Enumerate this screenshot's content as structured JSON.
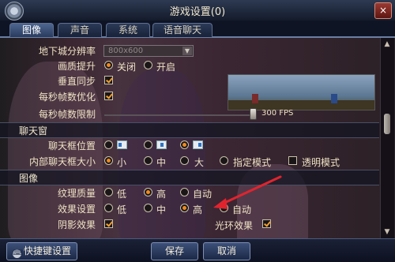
{
  "window": {
    "title": "游戏设置(0)",
    "close_glyph": "×"
  },
  "tabs": [
    {
      "label": "图像",
      "active": true
    },
    {
      "label": "声音",
      "active": false
    },
    {
      "label": "系统",
      "active": false
    },
    {
      "label": "语音聊天",
      "active": false
    }
  ],
  "settings": {
    "resolution": {
      "label": "地下城分辨率",
      "value": "800x600"
    },
    "quality": {
      "label": "画质提升",
      "options": [
        "关闭",
        "开启"
      ],
      "selected": 0
    },
    "vsync": {
      "label": "垂直同步",
      "checked": true
    },
    "fps_opt": {
      "label": "每秒帧数优化",
      "checked": true
    },
    "fps_limit": {
      "label": "每秒帧数限制",
      "value": "300 FPS"
    }
  },
  "chat_section": {
    "header": "聊天窗",
    "position": {
      "label": "聊天框位置",
      "selected": 2
    },
    "size": {
      "label": "内部聊天框大小",
      "options": [
        "小",
        "中",
        "大",
        "指定模式"
      ],
      "selected": 0,
      "transparent_label": "透明模式",
      "transparent_checked": false
    }
  },
  "image_section": {
    "header": "图像",
    "texture": {
      "label": "纹理质量",
      "options": [
        "低",
        "高",
        "自动"
      ],
      "selected": 1
    },
    "effects": {
      "label": "效果设置",
      "options": [
        "低",
        "中",
        "高",
        "自动"
      ],
      "selected": 2
    },
    "shadow": {
      "label": "阴影效果",
      "checked": true
    },
    "halo": {
      "label": "光环效果",
      "checked": true
    }
  },
  "footer": {
    "shortcut_label": "快捷键设置",
    "save_label": "保存",
    "cancel_label": "取消"
  },
  "colors": {
    "accent": "#f18a1e",
    "arrow": "#e0242e",
    "titlebar": "#1e2a40"
  },
  "icons": [
    "gear-icon",
    "close-icon",
    "keyboard-icon",
    "scroll-up-icon",
    "scroll-down-icon",
    "annotation-arrow-icon"
  ]
}
